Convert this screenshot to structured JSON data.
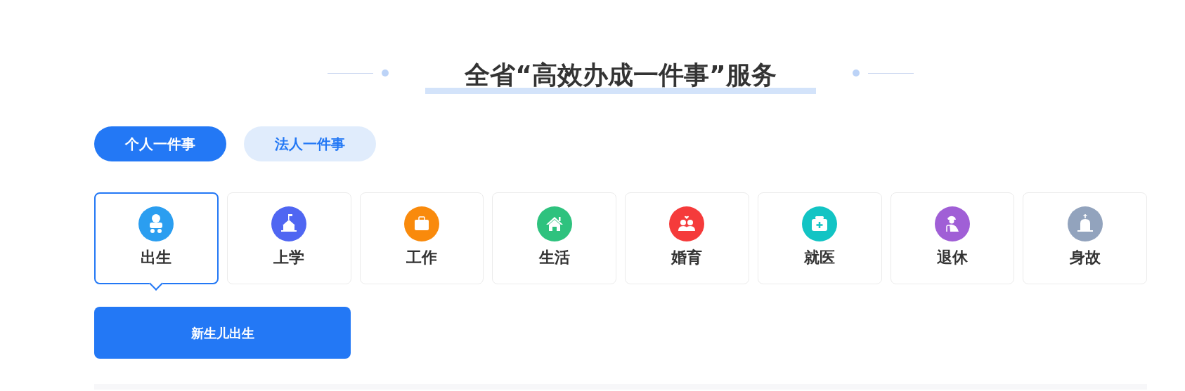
{
  "title": "全省“高效办成一件事”服务",
  "tabs": [
    {
      "label": "个人一件事",
      "selected": true
    },
    {
      "label": "法人一件事",
      "selected": false
    }
  ],
  "categories": [
    {
      "label": "出生",
      "color": "#2b9ef0",
      "selected": true
    },
    {
      "label": "上学",
      "color": "#4f66f2",
      "selected": false
    },
    {
      "label": "工作",
      "color": "#f98a0c",
      "selected": false
    },
    {
      "label": "生活",
      "color": "#2ec27e",
      "selected": false
    },
    {
      "label": "婚育",
      "color": "#f53b3b",
      "selected": false
    },
    {
      "label": "就医",
      "color": "#12c4c4",
      "selected": false
    },
    {
      "label": "退休",
      "color": "#a05fd6",
      "selected": false
    },
    {
      "label": "身故",
      "color": "#92a3bd",
      "selected": false
    }
  ],
  "items": [
    {
      "label": "新生儿出生"
    }
  ]
}
